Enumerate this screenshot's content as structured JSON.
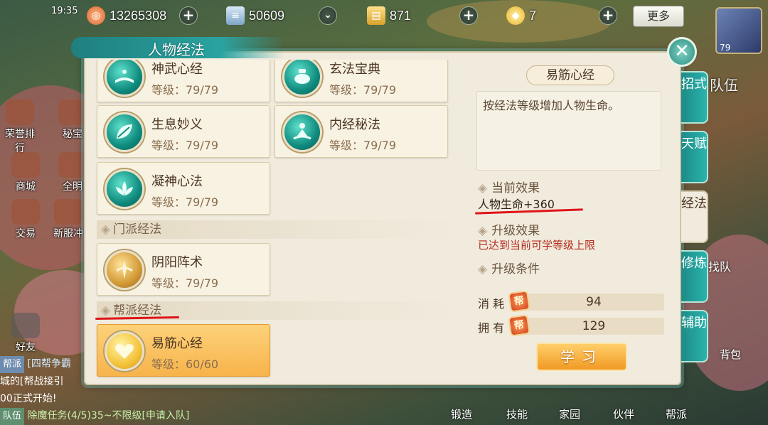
{
  "hud": {
    "clock": "19:35",
    "resources": [
      {
        "icon": "copper-coin-icon",
        "value": "13265308"
      },
      {
        "icon": "scroll-icon",
        "value": "50609"
      },
      {
        "icon": "paper-icon",
        "value": "871"
      },
      {
        "icon": "gold-ingot-icon",
        "value": "7"
      }
    ],
    "more_label": "更多",
    "avatar_level": "79",
    "team_label": "队伍",
    "find_team": "找队"
  },
  "left_menu": [
    {
      "label": "荣誉排行"
    },
    {
      "label": "秘宝"
    },
    {
      "label": "商城"
    },
    {
      "label": "全明"
    },
    {
      "label": "交易"
    },
    {
      "label": "新服冲"
    },
    {
      "label": "好友"
    }
  ],
  "chat": [
    {
      "tag": "帮派",
      "text": "[四帮争霸"
    },
    {
      "tag": "",
      "text": "城的[帮战接引"
    },
    {
      "tag": "",
      "text": "00正式开始!"
    },
    {
      "tag": "队伍",
      "text": "除魔任务(4/5)35~不限级[申请入队]"
    }
  ],
  "bottom_nav": [
    "锻造",
    "技能",
    "家园",
    "伙伴",
    "帮派"
  ],
  "bag_label": "背包",
  "dialog": {
    "title": "人物经法",
    "cards": [
      {
        "name": "神武心经",
        "level": "等级：79/79"
      },
      {
        "name": "玄法宝典",
        "level": "等级：79/79"
      },
      {
        "name": "生息妙义",
        "level": "等级：79/79"
      },
      {
        "name": "内经秘法",
        "level": "等级：79/79"
      },
      {
        "name": "凝神心法",
        "level": "等级：79/79"
      },
      {
        "name": "阴阳阵术",
        "level": "等级：79/79"
      },
      {
        "name": "易筋心经",
        "level": "等级：60/60"
      }
    ],
    "sections": {
      "sect": "门派经法",
      "guild": "帮派经法"
    },
    "detail": {
      "title": "易筋心经",
      "description": "按经法等级增加人物生命。",
      "current_effect_head": "当前效果",
      "current_effect": "人物生命+360",
      "upgrade_effect_head": "升级效果",
      "upgrade_effect": "已达到当前可学等级上限",
      "upgrade_cond_head": "升级条件",
      "cost_label": "消 耗",
      "cost_value": "94",
      "own_label": "拥 有",
      "own_value": "129",
      "coin_glyph": "帮",
      "learn_label": "学习"
    },
    "tabs": [
      "招式",
      "天赋",
      "经法",
      "修炼",
      "辅助"
    ],
    "active_tab": "经法"
  },
  "colors": {
    "teal_accent": "#2aa3a0",
    "selected_card": "#f7b34b",
    "red_text": "#b22a1a",
    "annotation_red": "#e0141a"
  }
}
